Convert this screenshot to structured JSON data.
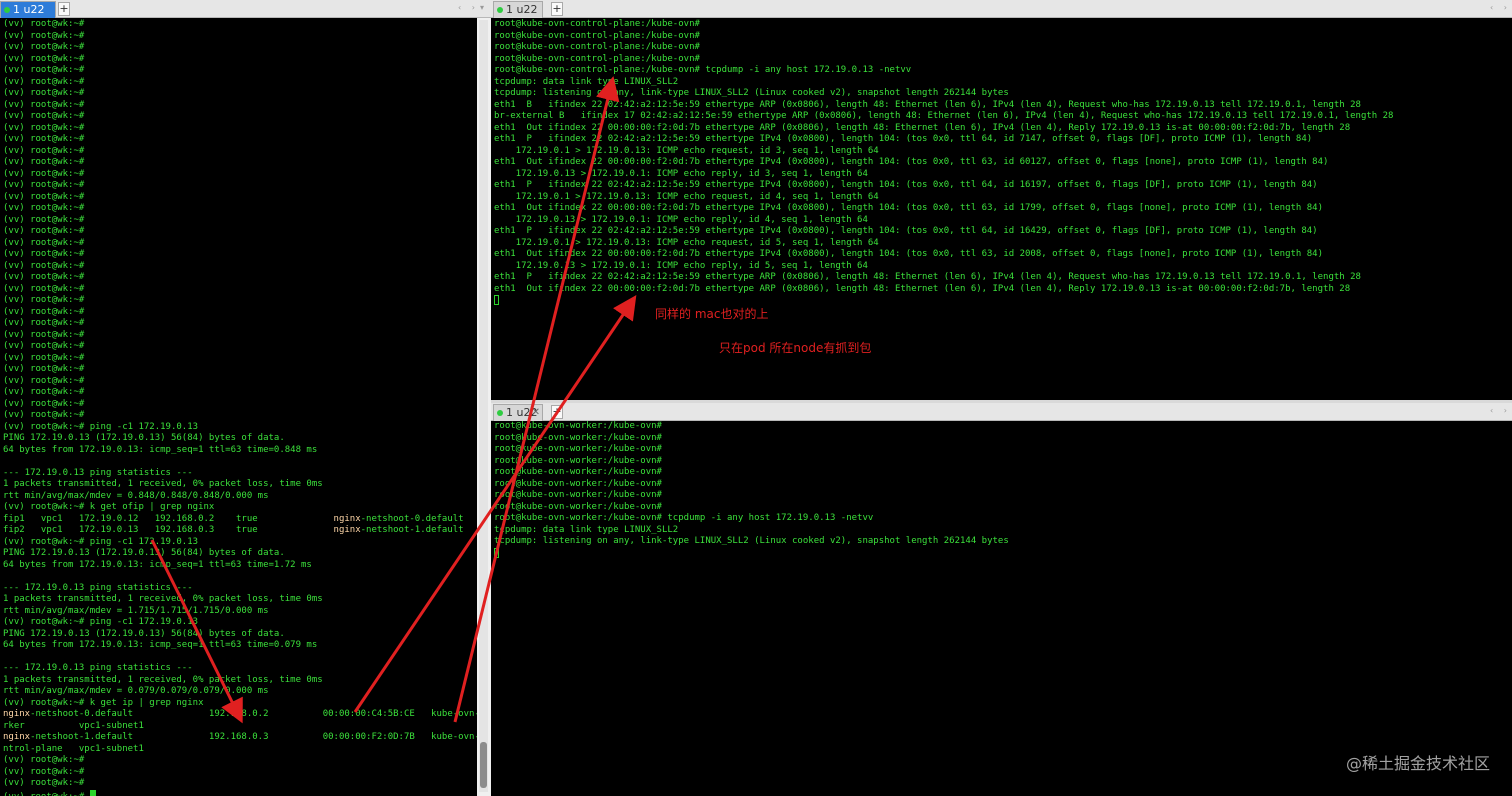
{
  "left_pane": {
    "tab_label": "1 u22",
    "new_tab_symbol": "+",
    "scroll_arrows": "‹ ›",
    "lines": [
      {
        "text": "(vv) root@wk:~#"
      },
      {
        "text": "(vv) root@wk:~#"
      },
      {
        "text": "(vv) root@wk:~#"
      },
      {
        "text": "(vv) root@wk:~#"
      },
      {
        "text": "(vv) root@wk:~#"
      },
      {
        "text": "(vv) root@wk:~#"
      },
      {
        "text": "(vv) root@wk:~#"
      },
      {
        "text": "(vv) root@wk:~#"
      },
      {
        "text": "(vv) root@wk:~#"
      },
      {
        "text": "(vv) root@wk:~#"
      },
      {
        "text": "(vv) root@wk:~#"
      },
      {
        "text": "(vv) root@wk:~#"
      },
      {
        "text": "(vv) root@wk:~#"
      },
      {
        "text": "(vv) root@wk:~#"
      },
      {
        "text": "(vv) root@wk:~#"
      },
      {
        "text": "(vv) root@wk:~#"
      },
      {
        "text": "(vv) root@wk:~#"
      },
      {
        "text": "(vv) root@wk:~#"
      },
      {
        "text": "(vv) root@wk:~#"
      },
      {
        "text": "(vv) root@wk:~#"
      },
      {
        "text": "(vv) root@wk:~#"
      },
      {
        "text": "(vv) root@wk:~#"
      },
      {
        "text": "(vv) root@wk:~#"
      },
      {
        "text": "(vv) root@wk:~#"
      },
      {
        "text": "(vv) root@wk:~#"
      },
      {
        "text": "(vv) root@wk:~#"
      },
      {
        "text": "(vv) root@wk:~#"
      },
      {
        "text": "(vv) root@wk:~#"
      },
      {
        "text": "(vv) root@wk:~#"
      },
      {
        "text": "(vv) root@wk:~#"
      },
      {
        "text": "(vv) root@wk:~#"
      },
      {
        "text": "(vv) root@wk:~#"
      },
      {
        "text": "(vv) root@wk:~#"
      },
      {
        "text": "(vv) root@wk:~#"
      },
      {
        "text": "(vv) root@wk:~#"
      },
      {
        "text": "(vv) root@wk:~# ping -c1 172.19.0.13"
      },
      {
        "text": "PING 172.19.0.13 (172.19.0.13) 56(84) bytes of data."
      },
      {
        "text": "64 bytes from 172.19.0.13: icmp_seq=1 ttl=63 time=0.848 ms"
      },
      {
        "text": ""
      },
      {
        "text": "--- 172.19.0.13 ping statistics ---"
      },
      {
        "text": "1 packets transmitted, 1 received, 0% packet loss, time 0ms"
      },
      {
        "text": "rtt min/avg/max/mdev = 0.848/0.848/0.848/0.000 ms"
      },
      {
        "text": "(vv) root@wk:~# k get ofip | grep nginx"
      },
      {
        "text": "fip1   vpc1   172.19.0.12   192.168.0.2    true              ",
        "hl": "nginx",
        "rest": "-netshoot-0.default"
      },
      {
        "text": "fip2   vpc1   172.19.0.13   192.168.0.3    true              ",
        "hl": "nginx",
        "rest": "-netshoot-1.default"
      },
      {
        "text": "(vv) root@wk:~# ping -c1 172.19.0.13"
      },
      {
        "text": "PING 172.19.0.13 (172.19.0.13) 56(84) bytes of data."
      },
      {
        "text": "64 bytes from 172.19.0.13: icmp_seq=1 ttl=63 time=1.72 ms"
      },
      {
        "text": ""
      },
      {
        "text": "--- 172.19.0.13 ping statistics ---"
      },
      {
        "text": "1 packets transmitted, 1 received, 0% packet loss, time 0ms"
      },
      {
        "text": "rtt min/avg/max/mdev = 1.715/1.715/1.715/0.000 ms"
      },
      {
        "text": "(vv) root@wk:~# ping -c1 172.19.0.13"
      },
      {
        "text": "PING 172.19.0.13 (172.19.0.13) 56(84) bytes of data."
      },
      {
        "text": "64 bytes from 172.19.0.13: icmp_seq=1 ttl=63 time=0.079 ms"
      },
      {
        "text": ""
      },
      {
        "text": "--- 172.19.0.13 ping statistics ---"
      },
      {
        "text": "1 packets transmitted, 1 received, 0% packet loss, time 0ms"
      },
      {
        "text": "rtt min/avg/max/mdev = 0.079/0.079/0.079/0.000 ms"
      },
      {
        "text": "(vv) root@wk:~# k get ip | grep nginx"
      },
      {
        "text": "",
        "hl": "nginx",
        "rest": "-netshoot-0.default              192.168.0.2          00:00:00:C4:5B:CE   kube-ovn-wo"
      },
      {
        "text": "rker          vpc1-subnet1"
      },
      {
        "text": "",
        "hl": "nginx",
        "rest": "-netshoot-1.default              192.168.0.3          00:00:00:F2:0D:7B   kube-ovn-co"
      },
      {
        "text": "ntrol-plane   vpc1-subnet1"
      },
      {
        "text": "(vv) root@wk:~#"
      },
      {
        "text": "(vv) root@wk:~#"
      },
      {
        "text": "(vv) root@wk:~#"
      },
      {
        "text": "(vv) root@wk:~# ",
        "cursor": "block"
      }
    ]
  },
  "top_right_pane": {
    "tab_label": "1 u22",
    "new_tab_symbol": "+",
    "scroll_arrows": "‹ ›",
    "lines": [
      {
        "text": "root@kube-ovn-control-plane:/kube-ovn#"
      },
      {
        "text": "root@kube-ovn-control-plane:/kube-ovn#"
      },
      {
        "text": "root@kube-ovn-control-plane:/kube-ovn#"
      },
      {
        "text": "root@kube-ovn-control-plane:/kube-ovn#"
      },
      {
        "text": "root@kube-ovn-control-plane:/kube-ovn# tcpdump -i any host 172.19.0.13 -netvv"
      },
      {
        "text": "tcpdump: data link type LINUX_SLL2"
      },
      {
        "text": "tcpdump: listening on any, link-type LINUX_SLL2 (Linux cooked v2), snapshot length 262144 bytes"
      },
      {
        "text": "eth1  B   ifindex 22 02:42:a2:12:5e:59 ethertype ARP (0x0806), length 48: Ethernet (len 6), IPv4 (len 4), Request who-has 172.19.0.13 tell 172.19.0.1, length 28"
      },
      {
        "text": "br-external B   ifindex 17 02:42:a2:12:5e:59 ethertype ARP (0x0806), length 48: Ethernet (len 6), IPv4 (len 4), Request who-has 172.19.0.13 tell 172.19.0.1, length 28"
      },
      {
        "text": "eth1  Out ifindex 22 00:00:00:f2:0d:7b ethertype ARP (0x0806), length 48: Ethernet (len 6), IPv4 (len 4), Reply 172.19.0.13 is-at 00:00:00:f2:0d:7b, length 28"
      },
      {
        "text": "eth1  P   ifindex 22 02:42:a2:12:5e:59 ethertype IPv4 (0x0800), length 104: (tos 0x0, ttl 64, id 7147, offset 0, flags [DF], proto ICMP (1), length 84)"
      },
      {
        "text": "    172.19.0.1 > 172.19.0.13: ICMP echo request, id 3, seq 1, length 64"
      },
      {
        "text": "eth1  Out ifindex 22 00:00:00:f2:0d:7b ethertype IPv4 (0x0800), length 104: (tos 0x0, ttl 63, id 60127, offset 0, flags [none], proto ICMP (1), length 84)"
      },
      {
        "text": "    172.19.0.13 > 172.19.0.1: ICMP echo reply, id 3, seq 1, length 64"
      },
      {
        "text": "eth1  P   ifindex 22 02:42:a2:12:5e:59 ethertype IPv4 (0x0800), length 104: (tos 0x0, ttl 64, id 16197, offset 0, flags [DF], proto ICMP (1), length 84)"
      },
      {
        "text": "    172.19.0.1 > 172.19.0.13: ICMP echo request, id 4, seq 1, length 64"
      },
      {
        "text": "eth1  Out ifindex 22 00:00:00:f2:0d:7b ethertype IPv4 (0x0800), length 104: (tos 0x0, ttl 63, id 1799, offset 0, flags [none], proto ICMP (1), length 84)"
      },
      {
        "text": "    172.19.0.13 > 172.19.0.1: ICMP echo reply, id 4, seq 1, length 64"
      },
      {
        "text": "eth1  P   ifindex 22 02:42:a2:12:5e:59 ethertype IPv4 (0x0800), length 104: (tos 0x0, ttl 64, id 16429, offset 0, flags [DF], proto ICMP (1), length 84)"
      },
      {
        "text": "    172.19.0.1 > 172.19.0.13: ICMP echo request, id 5, seq 1, length 64"
      },
      {
        "text": "eth1  Out ifindex 22 00:00:00:f2:0d:7b ethertype IPv4 (0x0800), length 104: (tos 0x0, ttl 63, id 2008, offset 0, flags [none], proto ICMP (1), length 84)"
      },
      {
        "text": "    172.19.0.13 > 172.19.0.1: ICMP echo reply, id 5, seq 1, length 64"
      },
      {
        "text": "eth1  P   ifindex 22 02:42:a2:12:5e:59 ethertype ARP (0x0806), length 48: Ethernet (len 6), IPv4 (len 4), Request who-has 172.19.0.13 tell 172.19.0.1, length 28"
      },
      {
        "text": "eth1  Out ifindex 22 00:00:00:f2:0d:7b ethertype ARP (0x0806), length 48: Ethernet (len 6), IPv4 (len 4), Reply 172.19.0.13 is-at 00:00:00:f2:0d:7b, length 28"
      },
      {
        "text": "",
        "cursor": "outline"
      }
    ]
  },
  "bottom_right_pane": {
    "tab_label": "1 u22",
    "new_tab_symbol": "+",
    "scroll_arrows": "‹ ›",
    "lines": [
      {
        "text": "root@kube-ovn-worker:/kube-ovn#"
      },
      {
        "text": "root@kube-ovn-worker:/kube-ovn#"
      },
      {
        "text": "root@kube-ovn-worker:/kube-ovn#"
      },
      {
        "text": "root@kube-ovn-worker:/kube-ovn#"
      },
      {
        "text": "root@kube-ovn-worker:/kube-ovn#"
      },
      {
        "text": "root@kube-ovn-worker:/kube-ovn#"
      },
      {
        "text": "root@kube-ovn-worker:/kube-ovn#"
      },
      {
        "text": "root@kube-ovn-worker:/kube-ovn#"
      },
      {
        "text": "root@kube-ovn-worker:/kube-ovn# tcpdump -i any host 172.19.0.13 -netvv"
      },
      {
        "text": "tcpdump: data link type LINUX_SLL2"
      },
      {
        "text": "tcpdump: listening on any, link-type LINUX_SLL2 (Linux cooked v2), snapshot length 262144 bytes"
      },
      {
        "text": "",
        "cursor": "outline"
      }
    ]
  },
  "annotations": {
    "mac_match": "同样的 mac也对的上",
    "only_pod_node": "只在pod 所在node有抓到包"
  },
  "watermark": "@稀土掘金技术社区",
  "colors": {
    "terminal_bg": "#000000",
    "terminal_text": "#3be03b",
    "highlight_text": "#ffd7a8",
    "tab_active": "#2e7cd9",
    "arrow_red": "#e02020"
  }
}
